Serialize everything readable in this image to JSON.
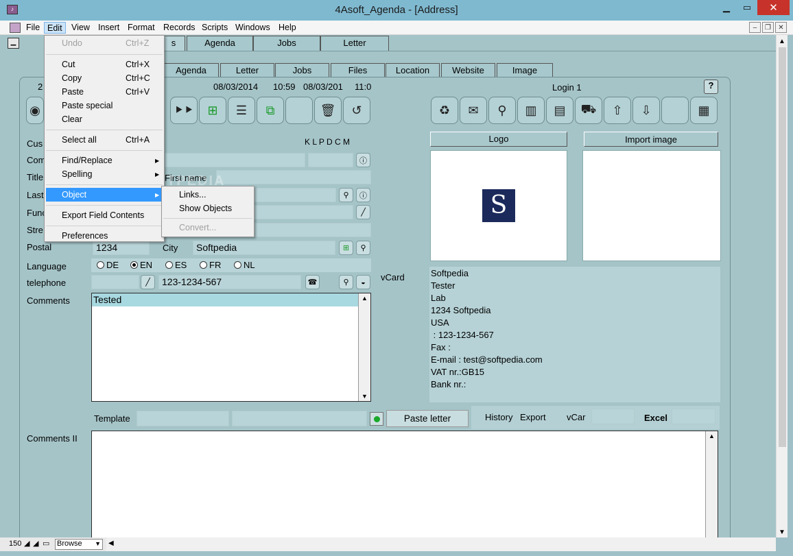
{
  "window": {
    "title": "4Asoft_Agenda - [Address]"
  },
  "menubar": {
    "items": [
      "File",
      "Edit",
      "View",
      "Insert",
      "Format",
      "Records",
      "Scripts",
      "Windows",
      "Help"
    ]
  },
  "top_tabs": [
    "s",
    "Agenda",
    "Jobs",
    "Letter"
  ],
  "sub_tabs": [
    "Agenda",
    "Letter",
    "Jobs",
    "Files",
    "Location",
    "Website",
    "Image"
  ],
  "header": {
    "record_num": "2",
    "date1": "08/03/2014",
    "time1": "10:59",
    "date2": "08/03/201",
    "time2": "11:0",
    "login": "Login  1",
    "help": "?",
    "klpdcm": "K L P D C M"
  },
  "labels": {
    "customer": "Cus",
    "company": "Com",
    "title": "Title",
    "first_name": "First name",
    "last": "Last",
    "function": "Func",
    "street": "Stre",
    "postal": "Postal",
    "city": "City",
    "language": "Language",
    "telephone": "telephone",
    "comments": "Comments",
    "template": "Template",
    "comments2": "Comments II",
    "vcard": "vCard",
    "history": "History",
    "export": "Export",
    "vcar": "vCar",
    "excel": "Excel"
  },
  "fields": {
    "postal": "1234",
    "city": "Softpedia",
    "telephone": "123-1234-567",
    "comments": "Tested"
  },
  "languages": [
    {
      "code": "DE",
      "selected": false
    },
    {
      "code": "EN",
      "selected": true
    },
    {
      "code": "ES",
      "selected": false
    },
    {
      "code": "FR",
      "selected": false
    },
    {
      "code": "NL",
      "selected": false
    }
  ],
  "buttons": {
    "logo": "Logo",
    "import_image": "Import image",
    "paste_letter": "Paste letter"
  },
  "logo": {
    "letter": "S",
    "bg": "#1b2a5a"
  },
  "vcard_lines": [
    "Softpedia",
    "Tester",
    "Lab",
    "1234 Softpedia",
    "USA",
    " : 123-1234-567",
    "Fax :",
    "E-mail : test@softpedia.com",
    "VAT nr.:GB15",
    "Bank nr.:"
  ],
  "edit_menu": {
    "items": [
      {
        "label": "Undo",
        "shortcut": "Ctrl+Z",
        "disabled": true
      },
      {
        "label": "Cut",
        "shortcut": "Ctrl+X"
      },
      {
        "label": "Copy",
        "shortcut": "Ctrl+C"
      },
      {
        "label": "Paste",
        "shortcut": "Ctrl+V"
      },
      {
        "label": "Paste special",
        "shortcut": ""
      },
      {
        "label": "Clear",
        "shortcut": ""
      },
      {
        "label": "Select all",
        "shortcut": "Ctrl+A"
      },
      {
        "label": "Find/Replace",
        "shortcut": ""
      },
      {
        "label": "Spelling",
        "shortcut": ""
      },
      {
        "label": "Object",
        "shortcut": ""
      },
      {
        "label": "Export Field Contents",
        "shortcut": ""
      },
      {
        "label": "Preferences",
        "shortcut": ""
      }
    ]
  },
  "object_submenu": {
    "items": [
      {
        "label": "Links..."
      },
      {
        "label": "Show Objects"
      },
      {
        "label": "Convert...",
        "disabled": true
      }
    ]
  },
  "status": {
    "zoom": "150",
    "mode": "Browse"
  },
  "watermark": "SOFTPEDIA"
}
